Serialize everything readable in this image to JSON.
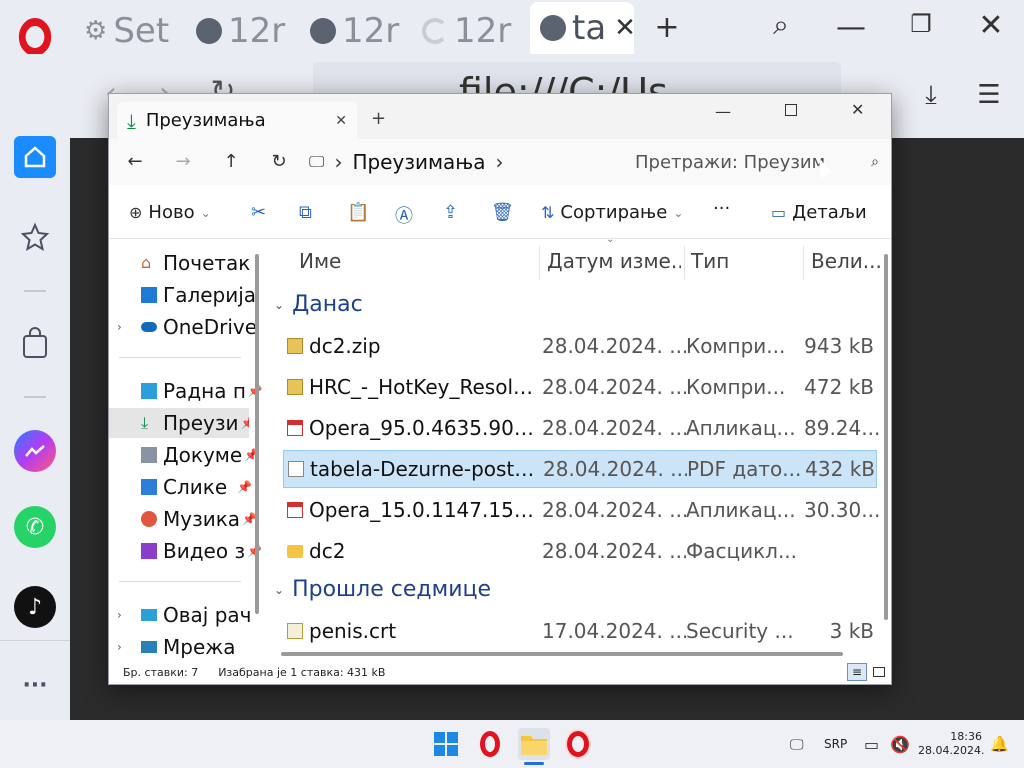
{
  "browser": {
    "tabs": [
      {
        "label": "Set"
      },
      {
        "label": "12r"
      },
      {
        "label": "12r"
      },
      {
        "label": "12r"
      },
      {
        "label": "ta"
      }
    ],
    "address": "file:///C:/Us"
  },
  "explorer": {
    "tab_title": "Преузимања",
    "breadcrumb": "Преузимања",
    "search_placeholder": "Претражи: Преузим",
    "commands": {
      "new": "Ново",
      "sort": "Сортирање",
      "more": "···",
      "details": "Детаљи"
    },
    "nav_pane": [
      {
        "label": "Почетак"
      },
      {
        "label": "Галерија"
      },
      {
        "label": "OneDrive"
      },
      {
        "label": "Радна п"
      },
      {
        "label": "Преузи"
      },
      {
        "label": "Докуме"
      },
      {
        "label": "Слике"
      },
      {
        "label": "Музика"
      },
      {
        "label": "Видео з"
      },
      {
        "label": "Овај рач"
      },
      {
        "label": "Мрежа"
      }
    ],
    "columns": {
      "name": "Име",
      "date": "Датум изме...",
      "type": "Тип",
      "size": "Вели..."
    },
    "groups": [
      {
        "label": "Данас",
        "files": [
          {
            "name": "dc2.zip",
            "date": "28.04.2024. ...",
            "type": "Компри...",
            "size": "943 kB",
            "icon": "zip-icon"
          },
          {
            "name": "HRC_-_HotKey_Resolu...",
            "date": "28.04.2024. ...",
            "type": "Компри...",
            "size": "472 kB",
            "icon": "zip-icon"
          },
          {
            "name": "Opera_95.0.4635.90_S...",
            "date": "28.04.2024. ...",
            "type": "Апликац...",
            "size": "89.24...",
            "icon": "installer-icon"
          },
          {
            "name": "tabela-Dezurne-poste...",
            "date": "28.04.2024. ...",
            "type": "PDF дато...",
            "size": "432 kB",
            "icon": "pdf-file-icon"
          },
          {
            "name": "Opera_15.0.1147.153_...",
            "date": "28.04.2024. ...",
            "type": "Апликац...",
            "size": "30.30...",
            "icon": "installer-icon"
          },
          {
            "name": "dc2",
            "date": "28.04.2024. ...",
            "type": "Фасцикл...",
            "size": "",
            "icon": "folder-icon"
          }
        ]
      },
      {
        "label": "Прошле седмице",
        "files": [
          {
            "name": "penis.crt",
            "date": "17.04.2024. ...",
            "type": "Security ...",
            "size": "3 kB",
            "icon": "certificate-icon"
          }
        ]
      }
    ],
    "status": {
      "items": "Бр. ставки: 7",
      "selected": "Изабрана је 1 ставка: 431 kB"
    }
  },
  "taskbar": {
    "lang": "SRP",
    "time": "18:36",
    "date": "28.04.2024."
  },
  "colors": {
    "accent": "#1e6fd9",
    "opera_red": "#e0141e",
    "selection": "#cce4f7"
  }
}
